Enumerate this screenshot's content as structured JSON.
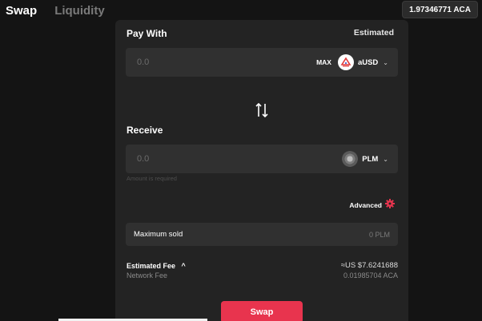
{
  "nav": {
    "tabs": [
      {
        "label": "Swap",
        "active": true
      },
      {
        "label": "Liquidity",
        "active": false
      }
    ]
  },
  "balance": "1.97346771 ACA",
  "pay": {
    "title": "Pay With",
    "estimated": "Estimated",
    "amount_placeholder": "0.0",
    "max_label": "MAX",
    "token": "aUSD",
    "token_icon": "ausd-logo-icon"
  },
  "receive": {
    "title": "Receive",
    "amount_placeholder": "0.0",
    "token": "PLM",
    "token_icon": "plm-logo-icon",
    "helper": "Amount is required"
  },
  "advanced": {
    "label": "Advanced",
    "icon": "gear-icon"
  },
  "maximum_sold": {
    "label": "Maximum sold",
    "value": "0 PLM"
  },
  "fees": {
    "estimated_label": "Estimated Fee",
    "estimated_toggle": "^",
    "estimated_value": "≈US $7.6241688",
    "network_label": "Network Fee",
    "network_value": "0.01985704 ACA"
  },
  "swap_button": "Swap",
  "colors": {
    "accent": "#e8344e",
    "background": "#141414",
    "card": "#232323",
    "field": "#303030"
  }
}
